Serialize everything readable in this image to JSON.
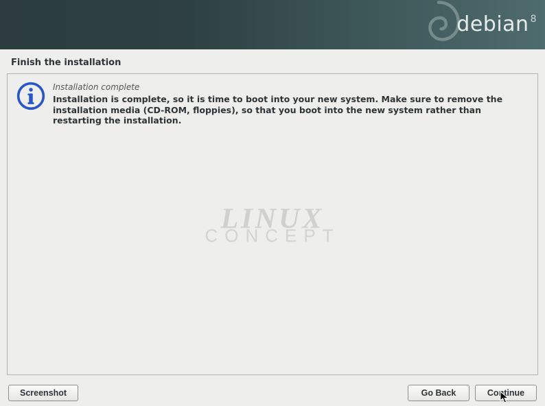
{
  "header": {
    "brand": "debian",
    "version": "8"
  },
  "page": {
    "title": "Finish the installation"
  },
  "message": {
    "subtitle": "Installation complete",
    "body": "Installation is complete, so it is time to boot into your new system. Make sure to remove the installation media (CD-ROM, floppies), so that you boot into the new system rather than restarting the installation."
  },
  "watermark": {
    "line1": "LINUX",
    "line2": "CONCEPT"
  },
  "buttons": {
    "screenshot": "Screenshot",
    "go_back": "Go Back",
    "continue": "Continue"
  }
}
